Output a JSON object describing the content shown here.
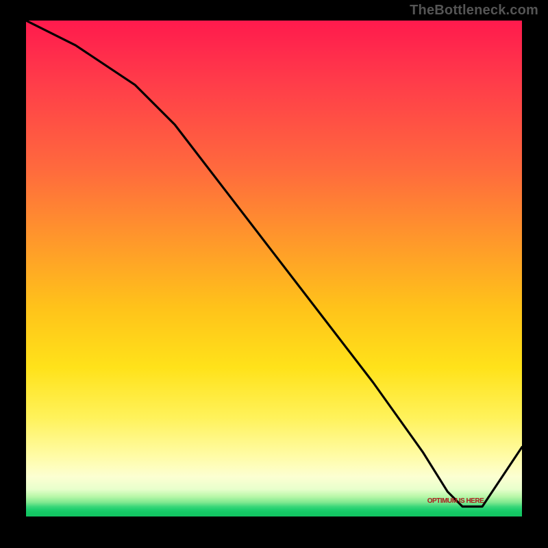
{
  "attribution": "TheBottleneck.com",
  "annotation_label": "OPTIMUM IS HERE",
  "chart_data": {
    "type": "line",
    "title": "",
    "xlabel": "",
    "ylabel": "",
    "xlim": [
      0,
      100
    ],
    "ylim": [
      0,
      100
    ],
    "x": [
      0,
      10,
      22,
      30,
      40,
      50,
      60,
      70,
      80,
      85,
      88,
      92,
      100
    ],
    "values": [
      100,
      95,
      87,
      79,
      66,
      53,
      40,
      27,
      13,
      5,
      2,
      2,
      14
    ],
    "optimum_x_range": [
      85,
      92
    ],
    "optimum_y": 2,
    "gradient_stops": [
      {
        "pos": 0.0,
        "color": "#ff1a4d"
      },
      {
        "pos": 0.45,
        "color": "#ff9a2a"
      },
      {
        "pos": 0.7,
        "color": "#ffe21a"
      },
      {
        "pos": 0.9,
        "color": "#fffca8"
      },
      {
        "pos": 0.98,
        "color": "#3bd77a"
      },
      {
        "pos": 1.0,
        "color": "#12c462"
      }
    ]
  }
}
